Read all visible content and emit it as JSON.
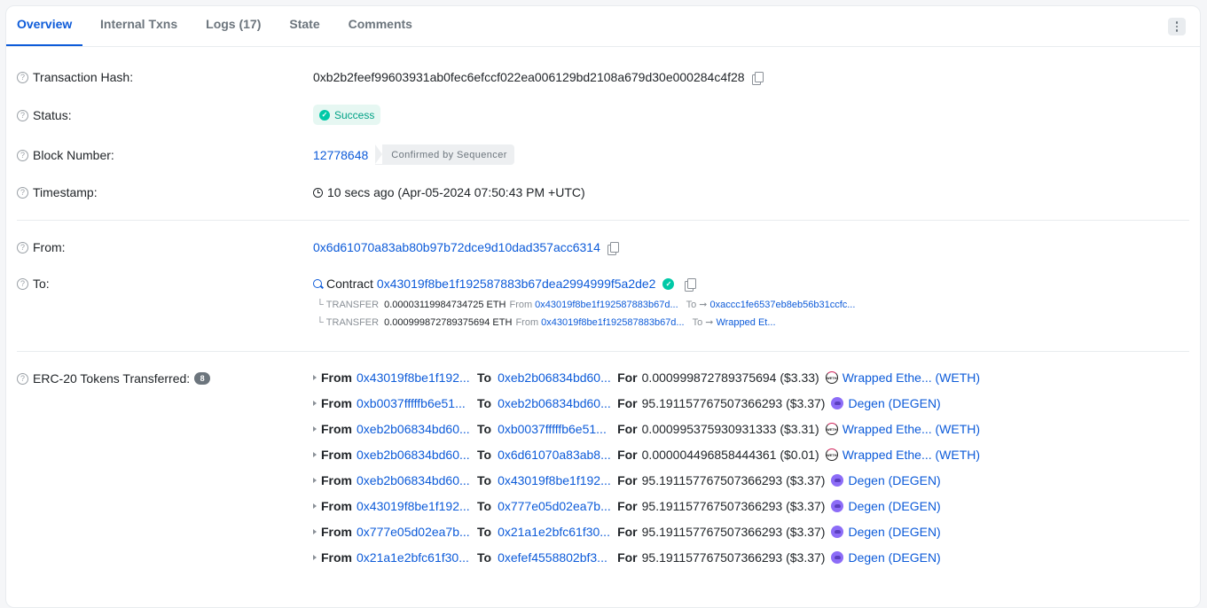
{
  "tabs": [
    {
      "label": "Overview",
      "active": true
    },
    {
      "label": "Internal Txns",
      "active": false
    },
    {
      "label": "Logs (17)",
      "active": false
    },
    {
      "label": "State",
      "active": false
    },
    {
      "label": "Comments",
      "active": false
    }
  ],
  "more_icon": "vertical-ellipsis-icon",
  "fields": {
    "tx_hash": {
      "label": "Transaction Hash:",
      "value": "0xb2b2feef99603931ab0fec6efccf022ea006129bd2108a679d30e000284c4f28"
    },
    "status": {
      "label": "Status:",
      "value": "Success"
    },
    "block": {
      "label": "Block Number:",
      "value": "12778648",
      "badge": "Confirmed by Sequencer"
    },
    "timestamp": {
      "label": "Timestamp:",
      "value": "10 secs ago (Apr-05-2024 07:50:43 PM +UTC)"
    },
    "from": {
      "label": "From:",
      "value": "0x6d61070a83ab80b97b72dce9d10dad357acc6314"
    },
    "to": {
      "label": "To:",
      "prefix": "Contract",
      "value": "0x43019f8be1f192587883b67dea2994999f5a2de2",
      "internal_transfers": [
        {
          "type": "TRANSFER",
          "amount": "0.00003119984734725 ETH",
          "from_label": "From",
          "from": "0x43019f8be1f192587883b67d...",
          "to_label": "To",
          "to": "0xaccc1fe6537eb8eb56b31ccfc..."
        },
        {
          "type": "TRANSFER",
          "amount": "0.000999872789375694 ETH",
          "from_label": "From",
          "from": "0x43019f8be1f192587883b67d...",
          "to_label": "To",
          "to": "Wrapped Et..."
        }
      ]
    },
    "erc20": {
      "label": "ERC-20 Tokens Transferred:",
      "count": "8",
      "from_kw": "From",
      "to_kw": "To",
      "for_kw": "For",
      "transfers": [
        {
          "from": "0x43019f8be1f192...",
          "to": "0xeb2b06834bd60...",
          "amount": "0.000999872789375694 ($3.33)",
          "token": "Wrapped Ethe... (WETH)",
          "icon": "weth"
        },
        {
          "from": "0xb0037fffffb6e51...",
          "to": "0xeb2b06834bd60...",
          "amount": "95.191157767507366293 ($3.37)",
          "token": "Degen (DEGEN)",
          "icon": "degen"
        },
        {
          "from": "0xeb2b06834bd60...",
          "to": "0xb0037fffffb6e51...",
          "amount": "0.000995375930931333 ($3.31)",
          "token": "Wrapped Ethe... (WETH)",
          "icon": "weth"
        },
        {
          "from": "0xeb2b06834bd60...",
          "to": "0x6d61070a83ab8...",
          "amount": "0.000004496858444361 ($0.01)",
          "token": "Wrapped Ethe... (WETH)",
          "icon": "weth"
        },
        {
          "from": "0xeb2b06834bd60...",
          "to": "0x43019f8be1f192...",
          "amount": "95.191157767507366293 ($3.37)",
          "token": "Degen (DEGEN)",
          "icon": "degen"
        },
        {
          "from": "0x43019f8be1f192...",
          "to": "0x777e05d02ea7b...",
          "amount": "95.191157767507366293 ($3.37)",
          "token": "Degen (DEGEN)",
          "icon": "degen"
        },
        {
          "from": "0x777e05d02ea7b...",
          "to": "0x21a1e2bfc61f30...",
          "amount": "95.191157767507366293 ($3.37)",
          "token": "Degen (DEGEN)",
          "icon": "degen"
        },
        {
          "from": "0x21a1e2bfc61f30...",
          "to": "0xefef4558802bf3...",
          "amount": "95.191157767507366293 ($3.37)",
          "token": "Degen (DEGEN)",
          "icon": "degen"
        }
      ]
    }
  },
  "colors": {
    "accent": "#0d5bd9",
    "success": "#00a186",
    "success_bg": "#e6f7f2",
    "degen": "#8c6cf7"
  }
}
